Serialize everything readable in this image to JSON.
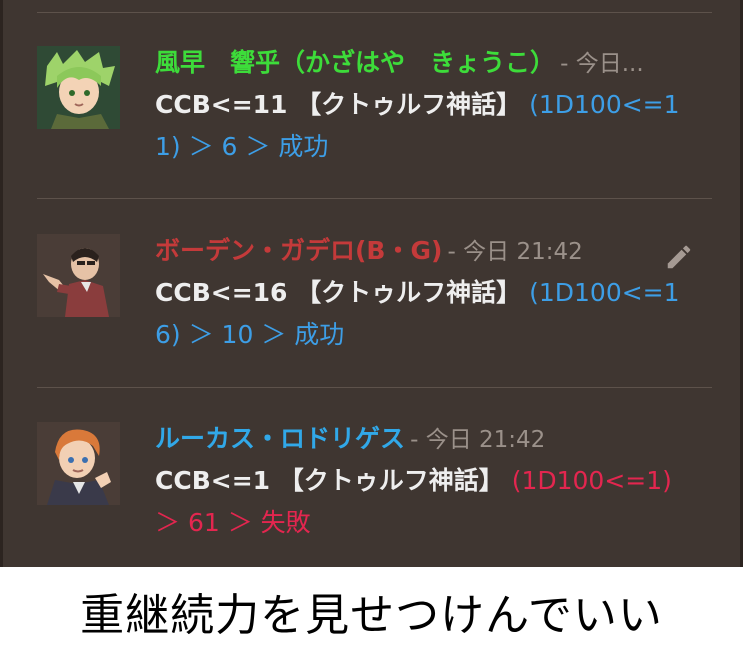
{
  "messages": [
    {
      "author": "風早　響乎（かざはや　きょうこ）",
      "author_color": "#3ddc3a",
      "timestamp": "- 今日...",
      "command": "CCB<=11 【クトゥルフ神話】",
      "result": "(1D100<=11) ＞ 6 ＞ 成功",
      "result_color": "#3d9ee6",
      "avatar": "green-haired-avatar"
    },
    {
      "author": "ボーデン・ガデロ(B・G)",
      "author_color": "#c43a3a",
      "timestamp": "- 今日 21:42",
      "command": "CCB<=16 【クトゥルフ神話】",
      "result": "(1D100<=16) ＞ 10 ＞ 成功",
      "result_color": "#3d9ee6",
      "avatar": "dark-haired-avatar",
      "edit_icon": "pencil-icon"
    },
    {
      "author": "ルーカス・ロドリゲス",
      "author_color": "#31a8e8",
      "timestamp": "- 今日 21:42",
      "command": "CCB<=1 【クトゥルフ神話】",
      "result": "(1D100<=1) ＞ 61 ＞ 失敗",
      "result_color": "#e3264f",
      "avatar": "ginger-haired-avatar"
    }
  ],
  "caption": "重継続力を見せつけんでいい"
}
